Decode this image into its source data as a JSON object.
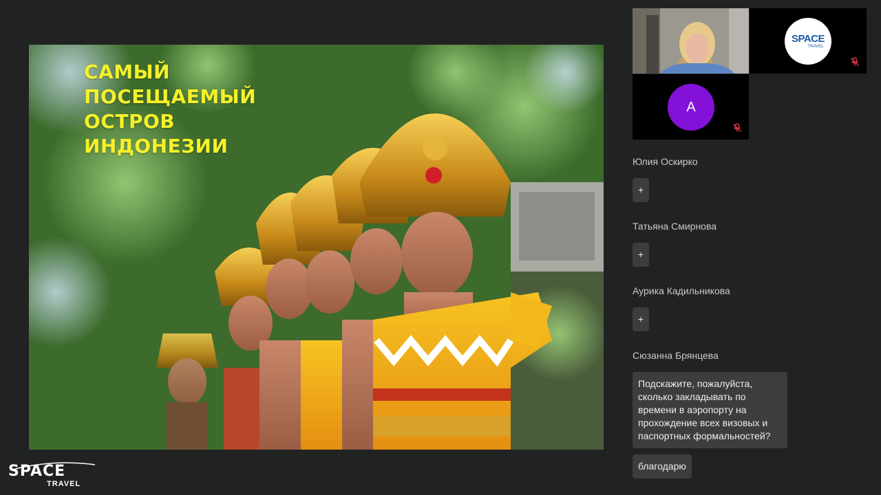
{
  "slide": {
    "title_lines": [
      "САМЫЙ",
      "ПОСЕЩАЕМЫЙ",
      "ОСТРОВ",
      "ИНДОНЕЗИИ"
    ]
  },
  "tiles": {
    "logo": {
      "brand_top": "SPACE",
      "brand_bottom": "TRAVEL"
    },
    "avatar": {
      "initial": "A",
      "color": "#8411d8"
    }
  },
  "chat": {
    "messages": [
      {
        "author": "Юлия Оскирко",
        "text": "+"
      },
      {
        "author": "Татьяна Смирнова",
        "text": "+"
      },
      {
        "author": "Аурика Кадильникова",
        "text": "+"
      },
      {
        "author": "Сюзанна Брянцева",
        "text": "Подскажите, пожалуйста,\nсколько закладывать по\nвремени в аэропорту на\nпрохождение всех визовых и\nпаспортных формальностей?"
      },
      {
        "author": "",
        "text": "благодарю"
      }
    ]
  },
  "brand": {
    "name": "SPACE",
    "sub": "TRAVEL"
  },
  "colors": {
    "background": "#202322",
    "title_yellow": "#f4f12a",
    "bubble": "#3b3e3d",
    "mic_off": "#e0344a"
  },
  "icons": [
    "mic-off-icon",
    "mic-off-icon"
  ]
}
